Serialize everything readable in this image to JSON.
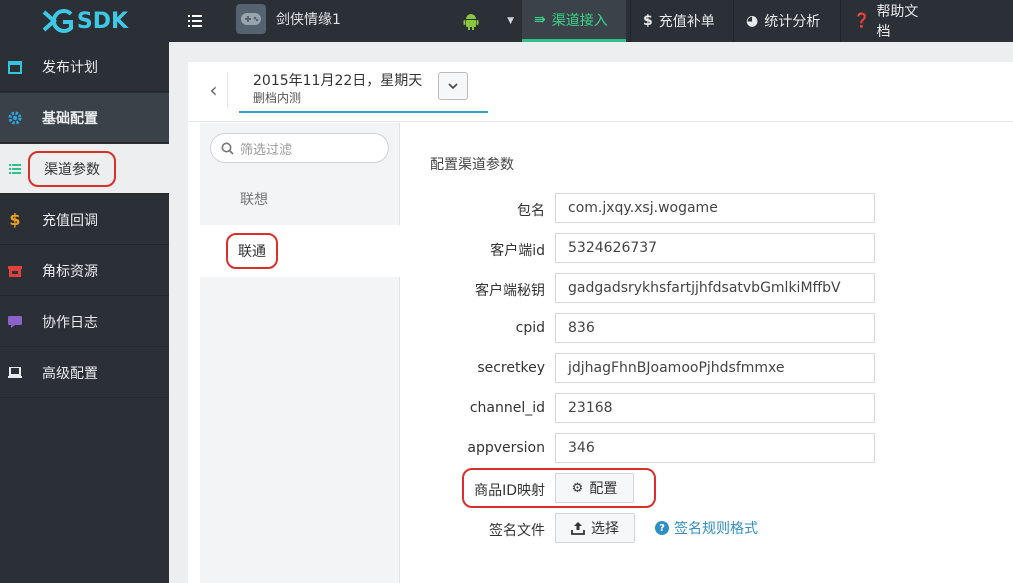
{
  "logo": {
    "text": "SDK"
  },
  "header": {
    "game_name": "剑侠情缘1",
    "tabs": [
      {
        "label": "渠道接入",
        "icon": "transfer-icon"
      },
      {
        "label": "充值补单",
        "icon": "dollar-icon"
      },
      {
        "label": "统计分析",
        "icon": "pie-chart-icon"
      },
      {
        "label": "帮助文档",
        "icon": "help-icon"
      }
    ]
  },
  "sidebar": {
    "items": [
      {
        "label": "发布计划",
        "icon": "calendar-icon"
      },
      {
        "label": "基础配置",
        "icon": "gear-icon"
      },
      {
        "label": "渠道参数",
        "icon": "list-icon"
      },
      {
        "label": "充值回调",
        "icon": "dollar-icon"
      },
      {
        "label": "角标资源",
        "icon": "box-icon"
      },
      {
        "label": "协作日志",
        "icon": "comment-icon"
      },
      {
        "label": "高级配置",
        "icon": "laptop-icon"
      }
    ]
  },
  "release": {
    "date": "2015年11月22日，星期天",
    "subtitle": "删档内测"
  },
  "channels": {
    "filter_placeholder": "筛选过滤",
    "items": [
      {
        "label": "联想"
      },
      {
        "label": "联通"
      }
    ]
  },
  "form": {
    "title": "配置渠道参数",
    "fields": [
      {
        "label": "包名",
        "value": "com.jxqy.xsj.wogame"
      },
      {
        "label": "客户端id",
        "value": "5324626737"
      },
      {
        "label": "客户端秘钥",
        "value": "gadgadsrykhsfartjjhfdsatvbGmlkiMffbV"
      },
      {
        "label": "cpid",
        "value": "836"
      },
      {
        "label": "secretkey",
        "value": "jdjhagFhnBJoamooPjhdsfmmxe"
      },
      {
        "label": "channel_id",
        "value": "23168"
      },
      {
        "label": "appversion",
        "value": "346"
      }
    ],
    "product_map": {
      "label": "商品ID映射",
      "button": "配置"
    },
    "sign_file": {
      "label": "签名文件",
      "button": "选择",
      "help": "签名规则格式"
    }
  },
  "colors": {
    "accent": "#2fc18a",
    "highlight": "#d9302b",
    "link": "#2f8fc4"
  }
}
